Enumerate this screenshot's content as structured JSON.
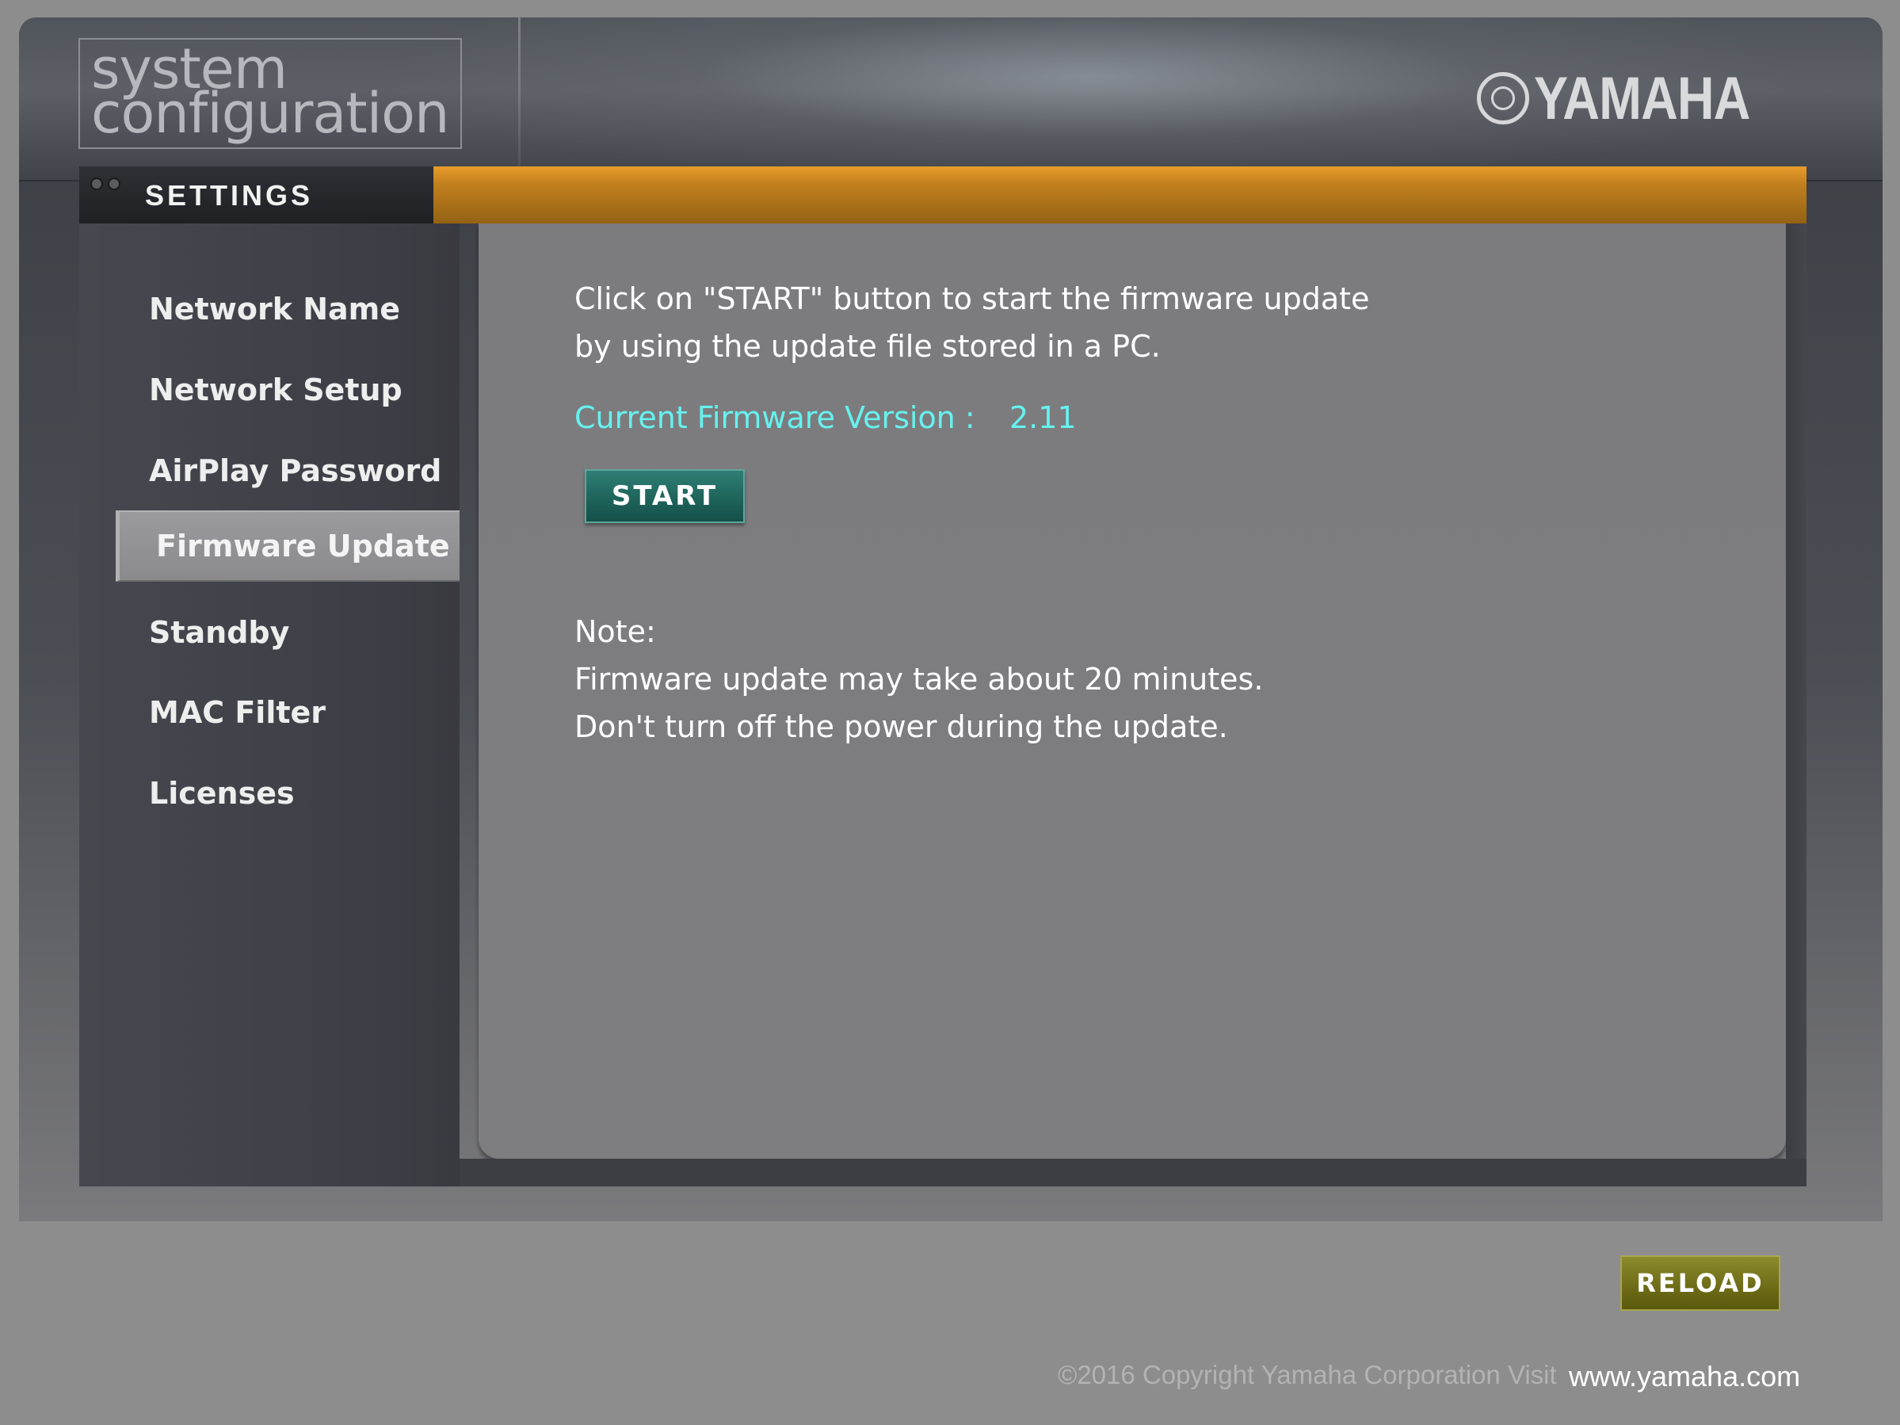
{
  "header": {
    "logo_line1": "system",
    "logo_line2": "configuration",
    "brand": "YAMAHA"
  },
  "settings_tab": {
    "label": "SETTINGS"
  },
  "sidebar": {
    "items": [
      {
        "label": "Network Name"
      },
      {
        "label": "Network Setup"
      },
      {
        "label": "AirPlay Password"
      },
      {
        "label": "Firmware Update",
        "active": true
      },
      {
        "label": "Standby"
      },
      {
        "label": "MAC Filter"
      },
      {
        "label": "Licenses"
      }
    ]
  },
  "main": {
    "instruction_line1": "Click on \"START\" button to start the firmware update",
    "instruction_line2": "by using the update file stored in a PC.",
    "firmware_label": "Current Firmware Version :",
    "firmware_version": "2.11",
    "start_button": "START",
    "note_title": "Note:",
    "note_line1": "Firmware update may take about 20 minutes.",
    "note_line2": "Don't turn off the power during the update."
  },
  "footer": {
    "reload_button": "RELOAD",
    "copyright": "©2016 Copyright Yamaha Corporation Visit",
    "site_link": "www.yamaha.com"
  },
  "colors": {
    "accent_orange": "#c2801e",
    "firmware_text": "#66f2ef",
    "start_button": "#1d6259",
    "reload_button": "#6f6d18"
  }
}
